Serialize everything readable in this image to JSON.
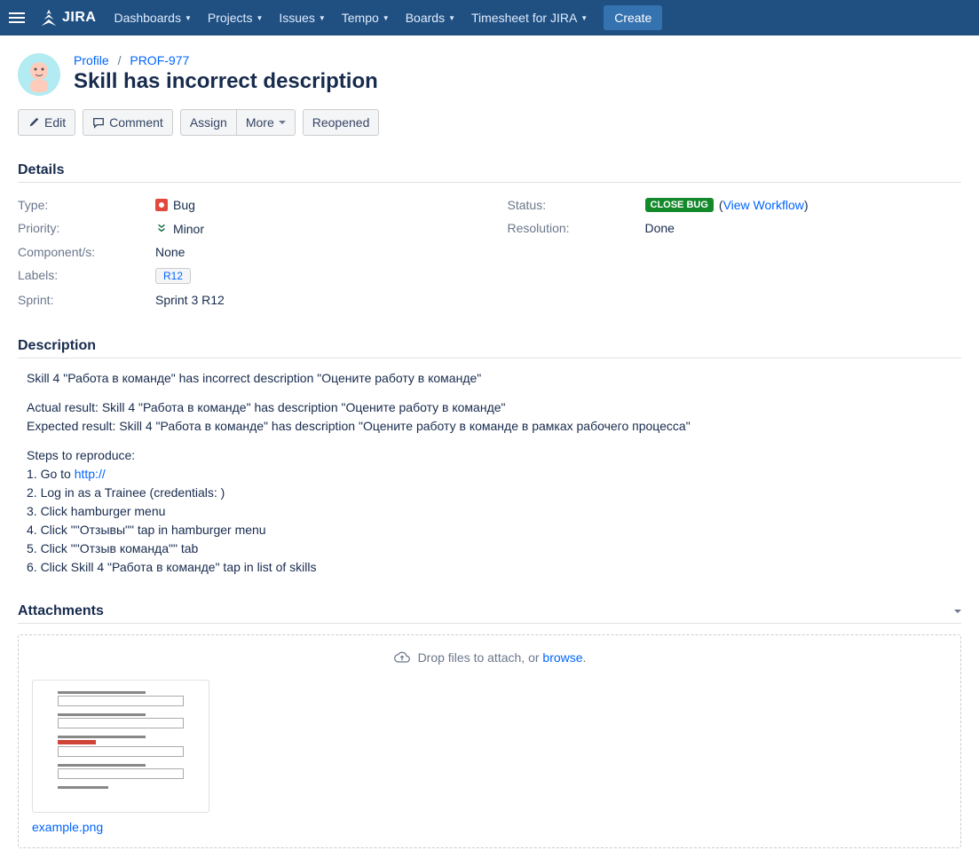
{
  "nav": {
    "logo": "JIRA",
    "items": [
      "Dashboards",
      "Projects",
      "Issues",
      "Tempo",
      "Boards",
      "Timesheet for JIRA"
    ],
    "create": "Create"
  },
  "breadcrumb": {
    "project": "Profile",
    "key": "PROF-977"
  },
  "title": "Skill has incorrect description",
  "toolbar": {
    "edit": "Edit",
    "comment": "Comment",
    "assign": "Assign",
    "more": "More",
    "reopened": "Reopened"
  },
  "sections": {
    "details": "Details",
    "description": "Description",
    "attachments": "Attachments"
  },
  "details": {
    "type_label": "Type:",
    "type_value": "Bug",
    "priority_label": "Priority:",
    "priority_value": "Minor",
    "components_label": "Component/s:",
    "components_value": "None",
    "labels_label": "Labels:",
    "labels_value": "R12",
    "sprint_label": "Sprint:",
    "sprint_value": "Sprint 3 R12",
    "status_label": "Status:",
    "status_value": "CLOSE BUG",
    "view_workflow": "View Workflow",
    "resolution_label": "Resolution:",
    "resolution_value": "Done"
  },
  "description": {
    "line1": "Skill 4 \"Работа в команде\" has incorrect description \"Оцените работу в команде\"",
    "line2": "Actual result: Skill 4 \"Работа в команде\" has description \"Оцените работу в команде\"",
    "line3": "Expected result: Skill 4 \"Работа в команде\" has description \"Оцените работу в команде в рамках рабочего процесса\"",
    "steps_title": "Steps to reproduce:",
    "step1a": "1. Go to ",
    "step1b": "http://",
    "step2": "2. Log in as a Trainee (credentials:           )",
    "step3": "3. Click hamburger menu",
    "step4": "4. Click \"\"Отзывы\"\" tap in hamburger menu",
    "step5": "5. Click \"\"Отзыв команда\"\" tab",
    "step6": "6. Click Skill 4 \"Работа в команде\" tap in list of skills"
  },
  "attachments": {
    "drop_text": "Drop files to attach, or ",
    "browse": "browse",
    "file_name": "example.png"
  }
}
